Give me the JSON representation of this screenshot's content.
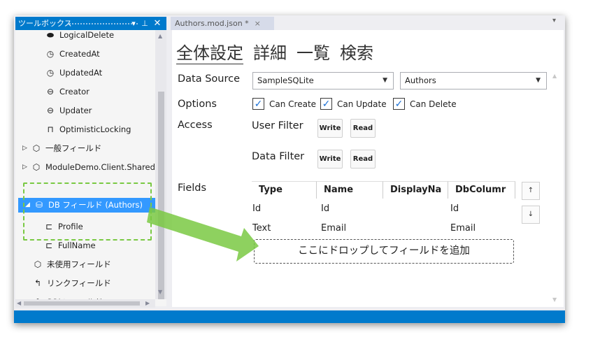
{
  "toolbox": {
    "title": "ツールボックス",
    "pin_icon": "pin-icon",
    "dropdown_icon": "chevron-down-icon",
    "close_icon": "close-icon",
    "items": [
      {
        "label": "LogicalDelete",
        "icon": "toggle-icon",
        "glyph": "⏺"
      },
      {
        "label": "CreatedAt",
        "icon": "clock-icon",
        "glyph": "⏱"
      },
      {
        "label": "UpdatedAt",
        "icon": "clock-icon",
        "glyph": "⏱"
      },
      {
        "label": "Creator",
        "icon": "link-icon",
        "glyph": "⚭"
      },
      {
        "label": "Updater",
        "icon": "link-icon",
        "glyph": "⚭"
      },
      {
        "label": "OptimisticLocking",
        "icon": "lock-icon",
        "glyph": "🔒"
      },
      {
        "label": "一般フィールド",
        "icon": "cube-icon",
        "glyph": "⬡",
        "expander": "▷"
      },
      {
        "label": "ModuleDemo.Client.Shared",
        "icon": "cube-icon",
        "glyph": "⬡",
        "expander": "▷"
      },
      {
        "label": "DB フィールド (Authors)",
        "icon": "database-icon",
        "glyph": "⛁",
        "expander": "◢",
        "selected": true
      },
      {
        "label": "Profile",
        "icon": "field-icon",
        "glyph": "⊏"
      },
      {
        "label": "FullName",
        "icon": "field-icon",
        "glyph": "⊏"
      },
      {
        "label": "未使用フィールド",
        "icon": "cube-icon",
        "glyph": "⬡"
      },
      {
        "label": "リンクフィールド",
        "icon": "link-field-icon",
        "glyph": "↰"
      },
      {
        "label": "SQLフィールド",
        "icon": "cube-icon",
        "glyph": "⬡"
      }
    ]
  },
  "document": {
    "tab_label": "Authors.mod.json *",
    "tab_close": "×",
    "big_tabs": [
      "全体設定",
      "詳細",
      "一覧",
      "検索"
    ],
    "data_source_label": "Data Source",
    "data_source_value": "SampleSQLite",
    "table_value": "Authors",
    "options_label": "Options",
    "options": [
      {
        "label": "Can Create",
        "checked": true
      },
      {
        "label": "Can Update",
        "checked": true
      },
      {
        "label": "Can Delete",
        "checked": true
      }
    ],
    "access_label": "Access",
    "user_filter_label": "User Filter",
    "data_filter_label": "Data Filter",
    "write_label": "Write",
    "read_label": "Read",
    "fields_label": "Fields",
    "columns": [
      "Type",
      "Name",
      "DisplayNa",
      "DbColumr"
    ],
    "rows": [
      {
        "type": "Id",
        "name": "Id",
        "display": "",
        "db": "Id"
      },
      {
        "type": "Text",
        "name": "Email",
        "display": "",
        "db": "Email"
      }
    ],
    "move_up": "↑",
    "move_down": "↓",
    "drop_zone": "ここにドロップしてフィールドを追加"
  },
  "colors": {
    "accent": "#007acc",
    "selection": "#3399ff",
    "drag_highlight": "#7ac943"
  }
}
